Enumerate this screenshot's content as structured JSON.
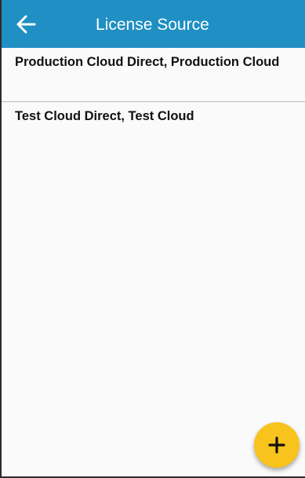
{
  "app_bar": {
    "title": "License Source",
    "back_icon": "arrow-left-icon",
    "background_color": "#1f8fc4"
  },
  "list": {
    "items": [
      {
        "label": "Production Cloud Direct, Production Cloud"
      },
      {
        "label": "Test Cloud Direct, Test Cloud"
      }
    ]
  },
  "fab": {
    "icon": "plus-icon",
    "background_color": "#f8c31c"
  }
}
